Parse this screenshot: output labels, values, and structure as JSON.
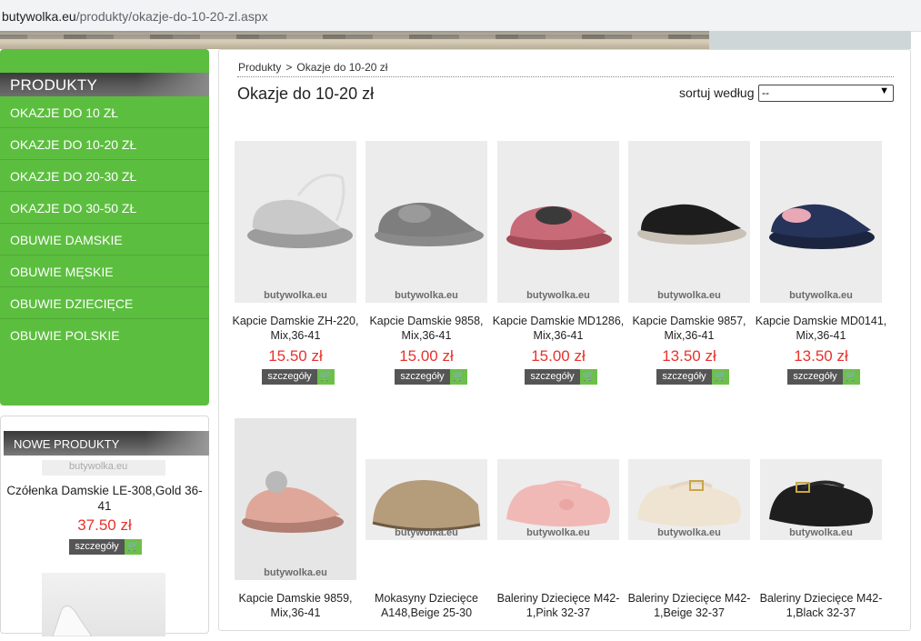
{
  "browser": {
    "url_host": "butywolka.eu",
    "url_path": "/produkty/okazje-do-10-20-zl.aspx"
  },
  "sidebar": {
    "title": "PRODUKTY",
    "items": [
      {
        "label": "OKAZJE DO 10 ZŁ"
      },
      {
        "label": "OKAZJE DO 10-20 ZŁ"
      },
      {
        "label": "OKAZJE DO 20-30 ZŁ"
      },
      {
        "label": "OKAZJE DO 30-50 ZŁ"
      },
      {
        "label": "OBUWIE DAMSKIE"
      },
      {
        "label": "OBUWIE MĘSKIE"
      },
      {
        "label": "OBUWIE DZIECIĘCE"
      },
      {
        "label": "OBUWIE POLSKIE"
      }
    ]
  },
  "new_products": {
    "title": "NOWE PRODUKTY",
    "watermark": "butywolka.eu",
    "item": {
      "name": "Czółenka Damskie LE-308,Gold 36-41",
      "price": "37.50 zł",
      "button": "szczegóły"
    }
  },
  "breadcrumb": {
    "root": "Produkty",
    "separator": ">",
    "current": "Okazje do 10-20 zł"
  },
  "page_title": "Okazje do 10-20 zł",
  "sort": {
    "label": "sortuj według",
    "selected": "--"
  },
  "products": [
    {
      "name": "Kapcie Damskie ZH-220, Mix,36-41",
      "price": "15.50 zł",
      "button": "szczegóły",
      "watermark": "butywolka.eu"
    },
    {
      "name": "Kapcie Damskie 9858, Mix,36-41",
      "price": "15.00 zł",
      "button": "szczegóły",
      "watermark": "butywolka.eu"
    },
    {
      "name": "Kapcie Damskie MD1286, Mix,36-41",
      "price": "15.00 zł",
      "button": "szczegóły",
      "watermark": "butywolka.eu"
    },
    {
      "name": "Kapcie Damskie 9857, Mix,36-41",
      "price": "13.50 zł",
      "button": "szczegóły",
      "watermark": "butywolka.eu"
    },
    {
      "name": "Kapcie Damskie MD0141, Mix,36-41",
      "price": "13.50 zł",
      "button": "szczegóły",
      "watermark": "butywolka.eu"
    },
    {
      "name": "Kapcie Damskie 9859, Mix,36-41",
      "watermark": "butywolka.eu"
    },
    {
      "name": "Mokasyny Dziecięce A148,Beige 25-30",
      "watermark": "butywolka.eu"
    },
    {
      "name": "Baleriny Dziecięce M42-1,Pink 32-37",
      "watermark": "butywolka.eu"
    },
    {
      "name": "Baleriny Dziecięce M42-1,Beige 32-37",
      "watermark": "butywolka.eu"
    },
    {
      "name": "Baleriny Dziecięce M42-1,Black 32-37",
      "watermark": "butywolka.eu"
    }
  ],
  "colors": {
    "sidebar_green": "#5cbe3f",
    "price_red": "#e8322c",
    "cart_green": "#6cc04a"
  }
}
